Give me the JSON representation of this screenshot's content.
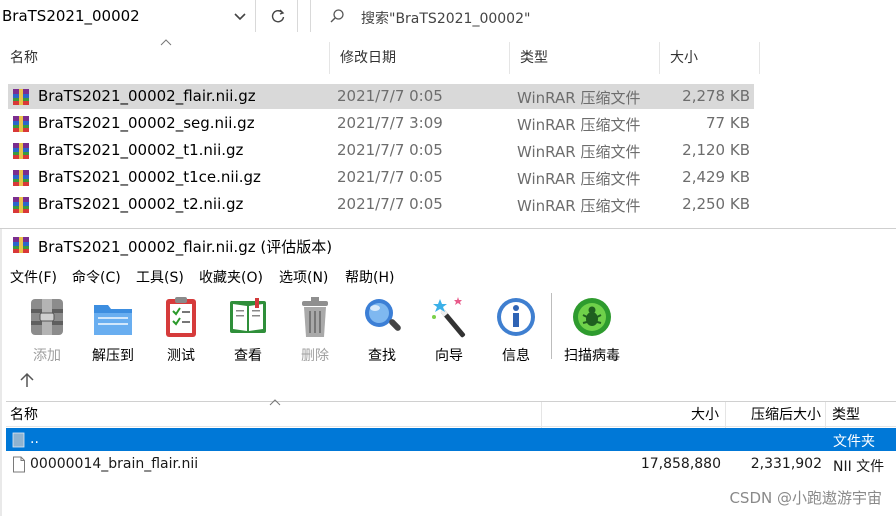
{
  "explorer": {
    "address": "BraTS2021_00002",
    "search_placeholder": "搜索\"BraTS2021_00002\"",
    "columns": {
      "name": "名称",
      "date": "修改日期",
      "type": "类型",
      "size": "大小"
    },
    "files": [
      {
        "name": "BraTS2021_00002_flair.nii.gz",
        "date": "2021/7/7 0:05",
        "type": "WinRAR 压缩文件",
        "size": "2,278 KB"
      },
      {
        "name": "BraTS2021_00002_seg.nii.gz",
        "date": "2021/7/7 3:09",
        "type": "WinRAR 压缩文件",
        "size": "77 KB"
      },
      {
        "name": "BraTS2021_00002_t1.nii.gz",
        "date": "2021/7/7 0:05",
        "type": "WinRAR 压缩文件",
        "size": "2,120 KB"
      },
      {
        "name": "BraTS2021_00002_t1ce.nii.gz",
        "date": "2021/7/7 0:05",
        "type": "WinRAR 压缩文件",
        "size": "2,429 KB"
      },
      {
        "name": "BraTS2021_00002_t2.nii.gz",
        "date": "2021/7/7 0:05",
        "type": "WinRAR 压缩文件",
        "size": "2,250 KB"
      }
    ]
  },
  "winrar": {
    "title": "BraTS2021_00002_flair.nii.gz (评估版本)",
    "menu": [
      "文件(F)",
      "命令(C)",
      "工具(S)",
      "收藏夹(O)",
      "选项(N)",
      "帮助(H)"
    ],
    "toolbar": [
      {
        "label": "添加",
        "icon": "add-archive-icon",
        "enabled": false
      },
      {
        "label": "解压到",
        "icon": "extract-folder-icon",
        "enabled": true
      },
      {
        "label": "测试",
        "icon": "test-clipboard-icon",
        "enabled": true
      },
      {
        "label": "查看",
        "icon": "view-book-icon",
        "enabled": true
      },
      {
        "label": "删除",
        "icon": "trash-can-icon",
        "enabled": false
      },
      {
        "label": "查找",
        "icon": "magnifier-icon",
        "enabled": true
      },
      {
        "label": "向导",
        "icon": "magic-wand-icon",
        "enabled": true
      },
      {
        "label": "信息",
        "icon": "info-icon",
        "enabled": true
      },
      {
        "label": "扫描病毒",
        "icon": "virus-scan-icon",
        "enabled": true
      }
    ],
    "columns": {
      "name": "名称",
      "size": "大小",
      "packed": "压缩后大小",
      "type": "类型"
    },
    "rows": [
      {
        "name": "..",
        "size": "",
        "packed": "",
        "type": "文件夹"
      },
      {
        "name": "00000014_brain_flair.nii",
        "size": "17,858,880",
        "packed": "2,331,902",
        "type": "NII 文件"
      }
    ]
  },
  "watermark": "CSDN @小跑遨游宇宙",
  "colors": {
    "selection_blue": "#0078d7",
    "explorer_selected": "#d9d9d9"
  }
}
